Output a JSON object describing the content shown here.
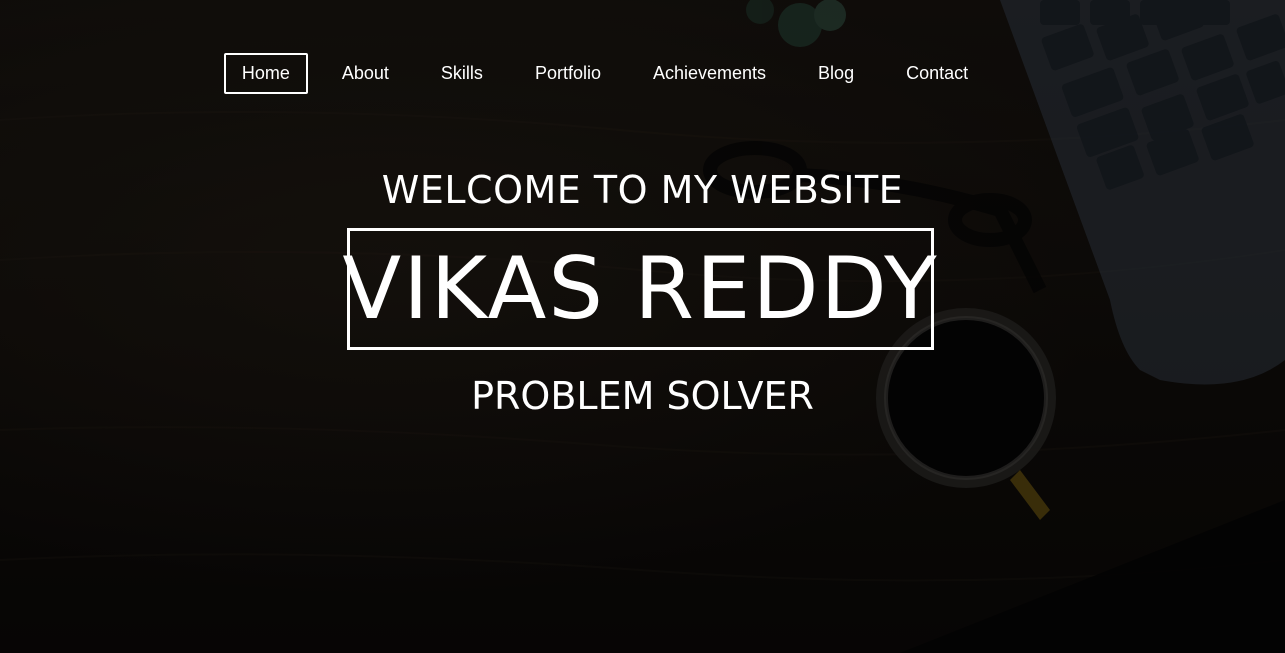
{
  "nav": {
    "items": [
      {
        "label": "Home",
        "active": true
      },
      {
        "label": "About"
      },
      {
        "label": "Skills"
      },
      {
        "label": "Portfolio"
      },
      {
        "label": "Achievements"
      },
      {
        "label": "Blog"
      },
      {
        "label": "Contact"
      }
    ]
  },
  "hero": {
    "welcome": "WELCOME TO MY WEBSITE",
    "name": "VIKAS REDDY",
    "tagline": "PROBLEM SOLVER"
  },
  "colors": {
    "text": "#ffffff",
    "background": "#0e0c0a"
  }
}
